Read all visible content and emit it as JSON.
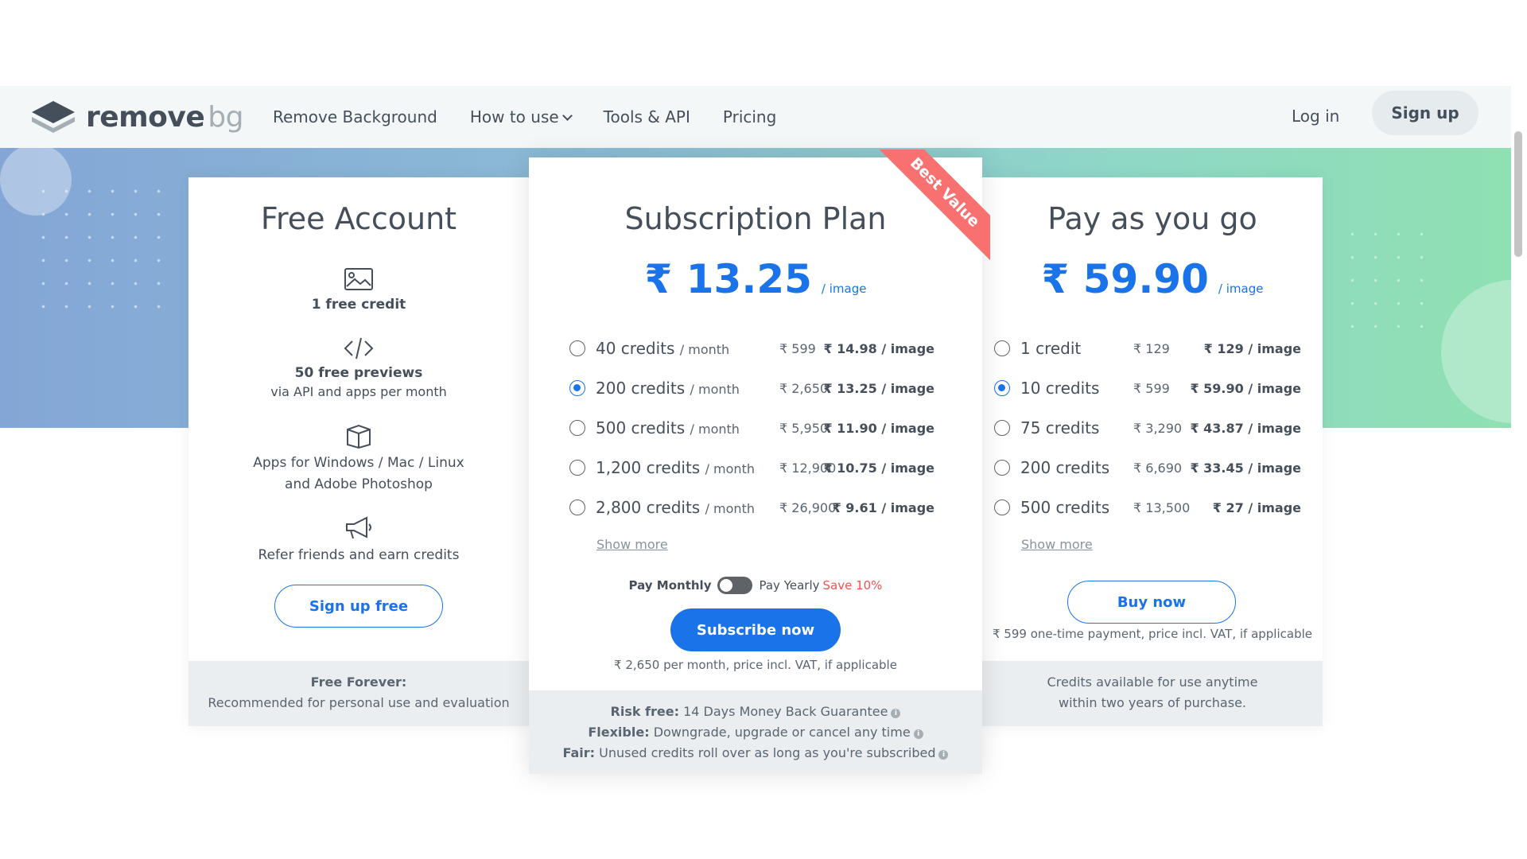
{
  "header": {
    "logo_main": "remove",
    "logo_sub": "bg",
    "nav": [
      "Remove Background",
      "How to use",
      "Tools & API",
      "Pricing"
    ],
    "login": "Log in",
    "signup": "Sign up"
  },
  "free": {
    "title": "Free Account",
    "feature1_bold": "1 free credit",
    "feature2_bold": "50 free previews",
    "feature2_sub": "via API and apps per month",
    "feature3_line1": "Apps for Windows / Mac / Linux",
    "feature3_line2": "and Adobe Photoshop",
    "feature4": "Refer friends and earn credits",
    "button": "Sign up free",
    "footer_bold": "Free Forever:",
    "footer_text": "Recommended for personal use and evaluation"
  },
  "subscription": {
    "title": "Subscription Plan",
    "ribbon": "Best Value",
    "price": "₹ 13.25",
    "price_unit": "/ image",
    "options": [
      {
        "credits": "40 credits",
        "per": "/ month",
        "price": "₹ 599",
        "per_image": "₹ 14.98 / image",
        "selected": false
      },
      {
        "credits": "200 credits",
        "per": "/ month",
        "price": "₹ 2,650",
        "per_image": "₹ 13.25 / image",
        "selected": true
      },
      {
        "credits": "500 credits",
        "per": "/ month",
        "price": "₹ 5,950",
        "per_image": "₹ 11.90 / image",
        "selected": false
      },
      {
        "credits": "1,200 credits",
        "per": "/ month",
        "price": "₹ 12,900",
        "per_image": "₹ 10.75 / image",
        "selected": false
      },
      {
        "credits": "2,800 credits",
        "per": "/ month",
        "price": "₹ 26,900",
        "per_image": "₹ 9.61 / image",
        "selected": false
      }
    ],
    "show_more": "Show more",
    "pay_monthly": "Pay Monthly",
    "pay_yearly": "Pay Yearly",
    "save": "Save 10%",
    "button": "Subscribe now",
    "note": "₹ 2,650 per month, price incl. VAT, if applicable",
    "footer": [
      {
        "bold": "Risk free:",
        "text": "14 Days Money Back Guarantee"
      },
      {
        "bold": "Flexible:",
        "text": "Downgrade, upgrade or cancel any time"
      },
      {
        "bold": "Fair:",
        "text": "Unused credits roll over as long as you're subscribed"
      }
    ]
  },
  "payg": {
    "title": "Pay as you go",
    "price": "₹ 59.90",
    "price_unit": "/ image",
    "options": [
      {
        "credits": "1 credit",
        "price": "₹ 129",
        "per_image": "₹ 129 / image",
        "selected": false
      },
      {
        "credits": "10 credits",
        "price": "₹ 599",
        "per_image": "₹ 59.90 / image",
        "selected": true
      },
      {
        "credits": "75 credits",
        "price": "₹ 3,290",
        "per_image": "₹ 43.87 / image",
        "selected": false
      },
      {
        "credits": "200 credits",
        "price": "₹ 6,690",
        "per_image": "₹ 33.45 / image",
        "selected": false
      },
      {
        "credits": "500 credits",
        "price": "₹ 13,500",
        "per_image": "₹ 27 / image",
        "selected": false
      }
    ],
    "show_more": "Show more",
    "button": "Buy now",
    "note": "₹ 599 one-time payment, price incl. VAT, if applicable",
    "footer_line1": "Credits available for use anytime",
    "footer_line2": "within two years of purchase."
  },
  "colors": {
    "accent": "#1a73e8",
    "ribbon": "#f87070",
    "text": "#454f5b"
  }
}
